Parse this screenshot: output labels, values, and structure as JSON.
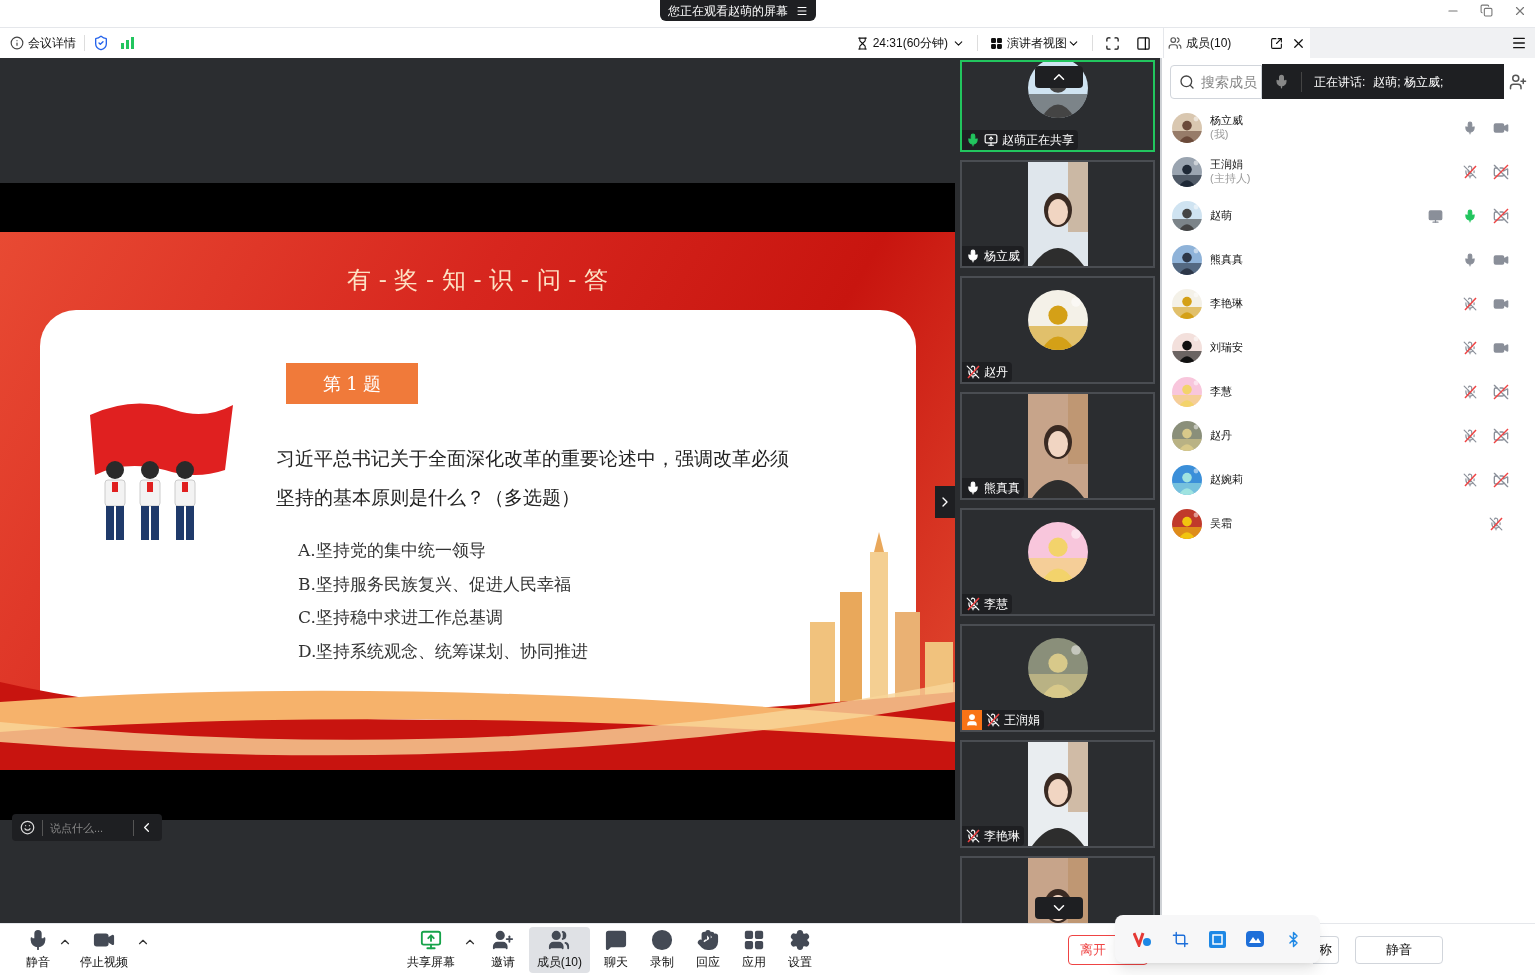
{
  "title_bar": {
    "banner": "您正在观看赵萌的屏幕"
  },
  "toolbar": {
    "meeting_info": "会议详情",
    "timer": "24:31(60分钟)",
    "view": "演讲者视图"
  },
  "slide": {
    "title": "有 - 奖 - 知 - 识 - 问 - 答",
    "badge": "第 1 题",
    "question": [
      "习近平总书记关于全面深化改革的重要论述中，强调改革必须",
      "坚持的基本原则是什么？（多选题）"
    ],
    "options": [
      "A.坚持党的集中统一领导",
      "B.坚持服务民族复兴、促进人民幸福",
      "C.坚持稳中求进工作总基调",
      "D.坚持系统观念、统筹谋划、协同推进"
    ]
  },
  "chat_input": {
    "placeholder": "说点什么..."
  },
  "video_tiles": [
    {
      "label": "赵萌正在共享",
      "kind": "avatar",
      "muted": false,
      "speaking": true,
      "sharing": true,
      "host": false,
      "selected": true
    },
    {
      "label": "杨立威",
      "kind": "video",
      "muted": false,
      "speaking": false,
      "sharing": false,
      "host": false,
      "selected": false
    },
    {
      "label": "赵丹",
      "kind": "avatar",
      "muted": true,
      "speaking": false,
      "sharing": false,
      "host": false,
      "selected": false
    },
    {
      "label": "熊真真",
      "kind": "video",
      "muted": false,
      "speaking": false,
      "sharing": false,
      "host": false,
      "selected": false
    },
    {
      "label": "李慧",
      "kind": "avatar",
      "muted": true,
      "speaking": false,
      "sharing": false,
      "host": false,
      "selected": false
    },
    {
      "label": "王润娟",
      "kind": "avatar",
      "muted": true,
      "speaking": false,
      "sharing": false,
      "host": true,
      "selected": false
    },
    {
      "label": "李艳琳",
      "kind": "video",
      "muted": true,
      "speaking": false,
      "sharing": false,
      "host": false,
      "selected": false
    },
    {
      "kind": "video",
      "selected": false
    }
  ],
  "members_panel": {
    "title": "成员(10)",
    "search_placeholder": "搜索成员",
    "speaking_label": "正在讲话:",
    "speaking_names": "赵萌; 杨立威;",
    "members": [
      {
        "name": "杨立威",
        "role": "(我)",
        "muted": false,
        "speaking": false,
        "has_camera": true,
        "camera_off": false,
        "sharing": false
      },
      {
        "name": "王润娟",
        "role": "(主持人)",
        "muted": true,
        "speaking": false,
        "has_camera": true,
        "camera_off": true,
        "sharing": false
      },
      {
        "name": "赵萌",
        "muted": false,
        "speaking": true,
        "has_camera": true,
        "camera_off": true,
        "sharing": true
      },
      {
        "name": "熊真真",
        "muted": false,
        "speaking": false,
        "has_camera": true,
        "camera_off": false,
        "sharing": false
      },
      {
        "name": "李艳琳",
        "muted": true,
        "speaking": false,
        "has_camera": true,
        "camera_off": false,
        "sharing": false
      },
      {
        "name": "刘瑞安",
        "muted": true,
        "speaking": false,
        "has_camera": true,
        "camera_off": false,
        "sharing": false
      },
      {
        "name": "李慧",
        "muted": true,
        "speaking": false,
        "has_camera": true,
        "camera_off": true,
        "sharing": false
      },
      {
        "name": "赵丹",
        "muted": true,
        "speaking": false,
        "has_camera": true,
        "camera_off": true,
        "sharing": false
      },
      {
        "name": "赵婉莉",
        "muted": true,
        "speaking": false,
        "has_camera": true,
        "camera_off": true,
        "sharing": false
      },
      {
        "name": "吴霜",
        "muted": true,
        "speaking": false,
        "has_camera": false,
        "sharing": false
      }
    ]
  },
  "bottom_bar": {
    "left": [
      {
        "label": "静音",
        "menu": true
      },
      {
        "label": "停止视频",
        "menu": true
      }
    ],
    "center": [
      {
        "label": "共享屏幕",
        "menu": true,
        "selected": false
      },
      {
        "label": "邀请",
        "selected": false
      },
      {
        "label": "成员(10)",
        "selected": true
      },
      {
        "label": "聊天",
        "selected": false
      },
      {
        "label": "录制",
        "selected": false
      },
      {
        "label": "回应",
        "selected": false
      },
      {
        "label": "应用",
        "selected": false
      },
      {
        "label": "设置",
        "selected": false
      }
    ],
    "leave_button": "离开",
    "rename_button": "称",
    "mute_all_button": "静音"
  }
}
